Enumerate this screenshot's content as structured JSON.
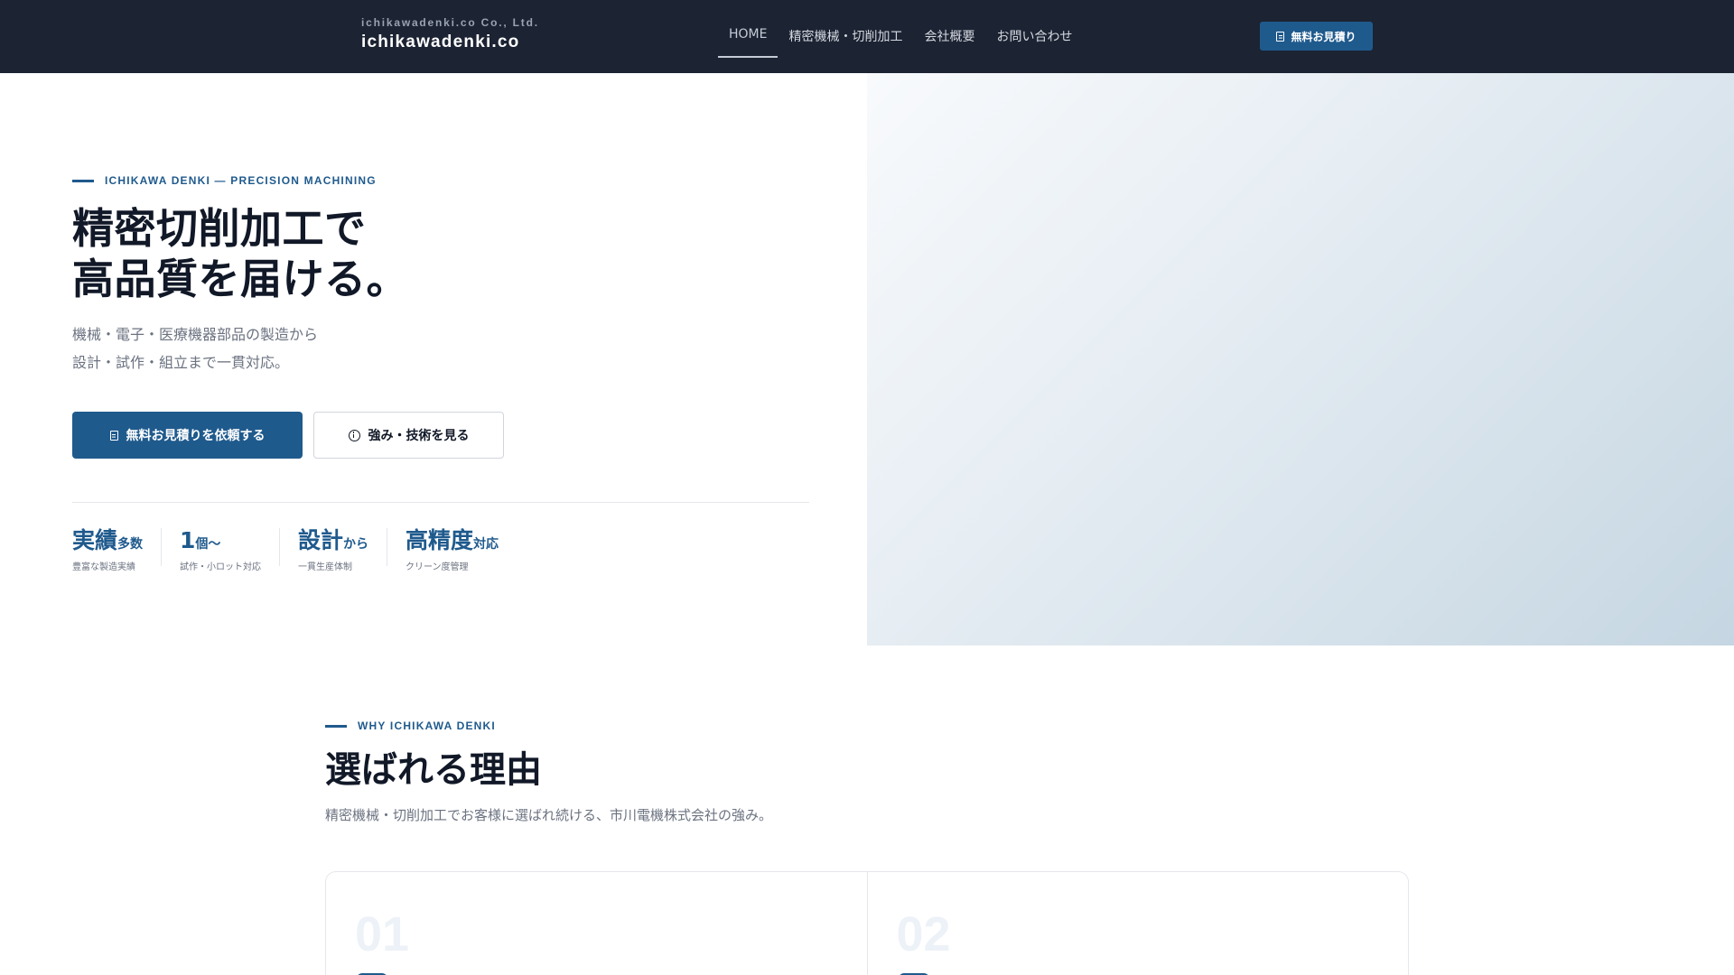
{
  "header": {
    "company_sub": "ichikawadenki.co Co., Ltd.",
    "company_name": "ichikawadenki.co",
    "nav": [
      {
        "label": "HOME"
      },
      {
        "label": "精密機械・切削加工"
      },
      {
        "label": "会社概要"
      },
      {
        "label": "お問い合わせ"
      }
    ],
    "cta_label": "無料お見積り"
  },
  "hero": {
    "eyebrow": "ICHIKAWA DENKI — PRECISION MACHINING",
    "title_line1": "精密切削加工で",
    "title_line2": "高品質を届ける。",
    "desc_line1": "機械・電子・医療機器部品の製造から",
    "desc_line2": "設計・試作・組立まで一貫対応。",
    "primary_button": "無料お見積りを依頼する",
    "secondary_button": "強み・技術を見る",
    "stats": [
      {
        "value": "実績",
        "suffix": "多数",
        "label": "豊富な製造実績"
      },
      {
        "value": "1",
        "suffix": "個〜",
        "label": "試作・小ロット対応"
      },
      {
        "value": "設計",
        "suffix": "から",
        "label": "一貫生産体制"
      },
      {
        "value": "高精度",
        "suffix": "対応",
        "label": "クリーン度管理"
      }
    ]
  },
  "why": {
    "eyebrow": "WHY ICHIKAWA DENKI",
    "title": "選ばれる理由",
    "desc": "精密機械・切削加工でお客様に選ばれ続ける、市川電機株式会社の強み。",
    "cards": [
      {
        "number": "01"
      },
      {
        "number": "02"
      }
    ]
  },
  "colors": {
    "header_bg": "#1c2333",
    "accent": "#1f5a8d",
    "text_dark": "#111827",
    "text_muted": "#6b7280"
  },
  "icons": {
    "cta": "document-icon",
    "secondary": "info-icon"
  }
}
